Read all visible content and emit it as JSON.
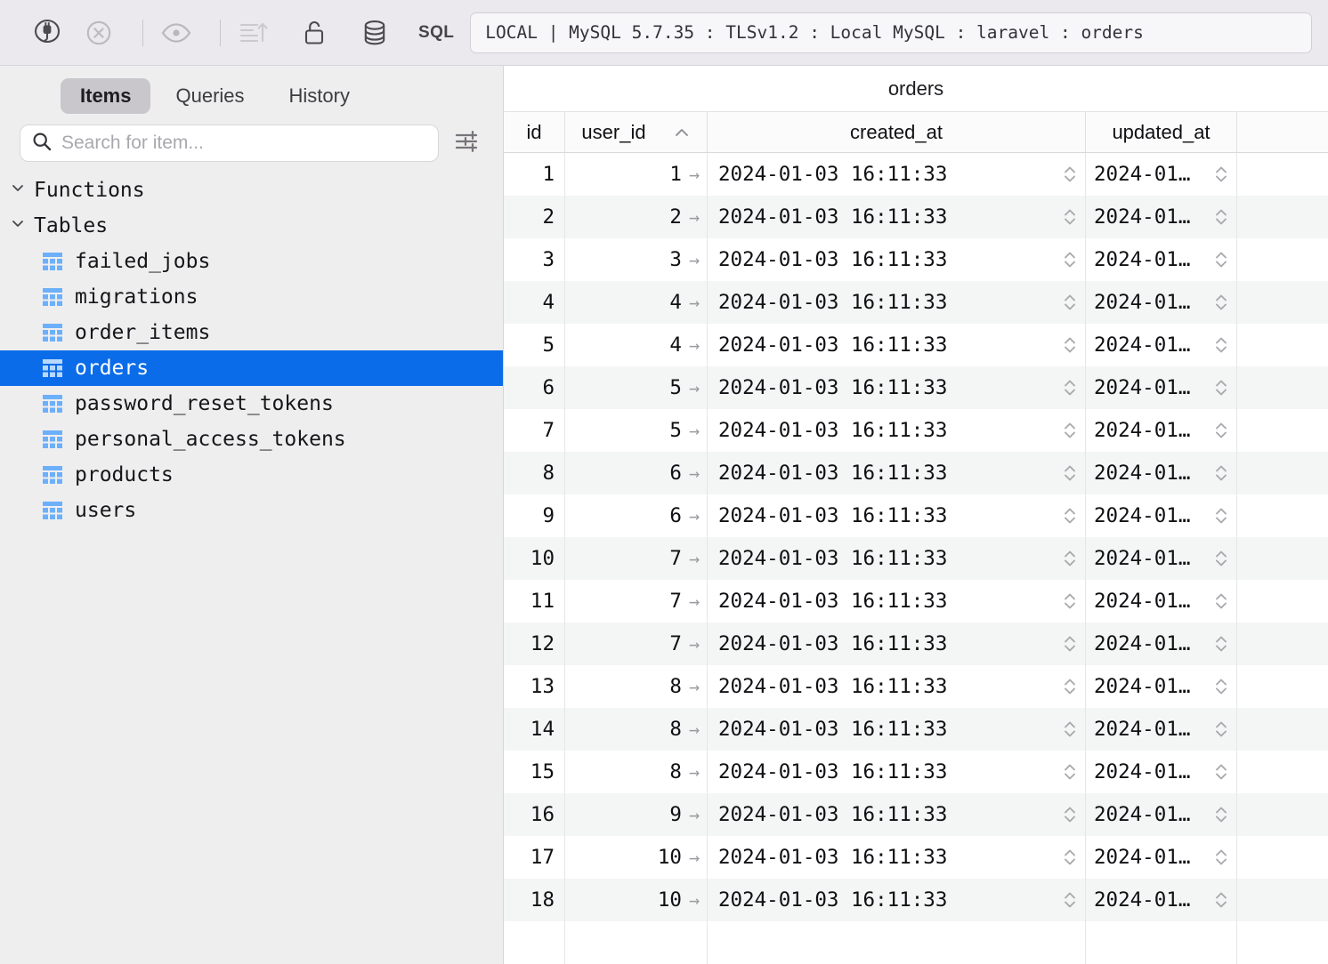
{
  "toolbar": {
    "icons": [
      {
        "name": "connect-plug-icon",
        "label": "Connect"
      },
      {
        "name": "disconnect-icon",
        "label": "Disconnect"
      },
      {
        "name": "eye-icon",
        "label": "Preview"
      },
      {
        "name": "sort-ascending-icon",
        "label": "Sort"
      },
      {
        "name": "unlock-icon",
        "label": "Unlock"
      },
      {
        "name": "database-icon",
        "label": "Database"
      }
    ],
    "sql_label": "SQL",
    "connection": "LOCAL | MySQL 5.7.35 : TLSv1.2 : Local MySQL : laravel : orders"
  },
  "sidebar": {
    "tabs": [
      {
        "label": "Items",
        "active": true
      },
      {
        "label": "Queries",
        "active": false
      },
      {
        "label": "History",
        "active": false
      }
    ],
    "search": {
      "placeholder": "Search for item...",
      "value": "",
      "icon": "search-icon",
      "filter_icon": "filter-sliders-icon"
    },
    "tree": [
      {
        "type": "group",
        "label": "Functions",
        "expanded": true,
        "children": []
      },
      {
        "type": "group",
        "label": "Tables",
        "expanded": true,
        "children": [
          {
            "label": "failed_jobs",
            "selected": false
          },
          {
            "label": "migrations",
            "selected": false
          },
          {
            "label": "order_items",
            "selected": false
          },
          {
            "label": "orders",
            "selected": true
          },
          {
            "label": "password_reset_tokens",
            "selected": false
          },
          {
            "label": "personal_access_tokens",
            "selected": false
          },
          {
            "label": "products",
            "selected": false
          },
          {
            "label": "users",
            "selected": false
          }
        ]
      }
    ]
  },
  "grid": {
    "title": "orders",
    "columns": [
      {
        "key": "id",
        "label": "id",
        "sort": null
      },
      {
        "key": "user_id",
        "label": "user_id",
        "sort": "asc"
      },
      {
        "key": "created_at",
        "label": "created_at",
        "sort": null
      },
      {
        "key": "updated_at",
        "label": "updated_at",
        "sort": null
      }
    ],
    "rows": [
      {
        "id": "1",
        "user_id": "1",
        "created_at": "2024-01-03 16:11:33",
        "updated_at": "2024-01…"
      },
      {
        "id": "2",
        "user_id": "2",
        "created_at": "2024-01-03 16:11:33",
        "updated_at": "2024-01…"
      },
      {
        "id": "3",
        "user_id": "3",
        "created_at": "2024-01-03 16:11:33",
        "updated_at": "2024-01…"
      },
      {
        "id": "4",
        "user_id": "4",
        "created_at": "2024-01-03 16:11:33",
        "updated_at": "2024-01…"
      },
      {
        "id": "5",
        "user_id": "4",
        "created_at": "2024-01-03 16:11:33",
        "updated_at": "2024-01…"
      },
      {
        "id": "6",
        "user_id": "5",
        "created_at": "2024-01-03 16:11:33",
        "updated_at": "2024-01…"
      },
      {
        "id": "7",
        "user_id": "5",
        "created_at": "2024-01-03 16:11:33",
        "updated_at": "2024-01…"
      },
      {
        "id": "8",
        "user_id": "6",
        "created_at": "2024-01-03 16:11:33",
        "updated_at": "2024-01…"
      },
      {
        "id": "9",
        "user_id": "6",
        "created_at": "2024-01-03 16:11:33",
        "updated_at": "2024-01…"
      },
      {
        "id": "10",
        "user_id": "7",
        "created_at": "2024-01-03 16:11:33",
        "updated_at": "2024-01…"
      },
      {
        "id": "11",
        "user_id": "7",
        "created_at": "2024-01-03 16:11:33",
        "updated_at": "2024-01…"
      },
      {
        "id": "12",
        "user_id": "7",
        "created_at": "2024-01-03 16:11:33",
        "updated_at": "2024-01…"
      },
      {
        "id": "13",
        "user_id": "8",
        "created_at": "2024-01-03 16:11:33",
        "updated_at": "2024-01…"
      },
      {
        "id": "14",
        "user_id": "8",
        "created_at": "2024-01-03 16:11:33",
        "updated_at": "2024-01…"
      },
      {
        "id": "15",
        "user_id": "8",
        "created_at": "2024-01-03 16:11:33",
        "updated_at": "2024-01…"
      },
      {
        "id": "16",
        "user_id": "9",
        "created_at": "2024-01-03 16:11:33",
        "updated_at": "2024-01…"
      },
      {
        "id": "17",
        "user_id": "10",
        "created_at": "2024-01-03 16:11:33",
        "updated_at": "2024-01…"
      },
      {
        "id": "18",
        "user_id": "10",
        "created_at": "2024-01-03 16:11:33",
        "updated_at": "2024-01…"
      }
    ]
  },
  "colors": {
    "selection_blue": "#0a6ce8",
    "toolbar_bg": "#ebe9ed",
    "sidebar_bg": "#efeeef",
    "row_alt": "#f4f5f5",
    "table_icon_blue": "#6cb0fb"
  }
}
